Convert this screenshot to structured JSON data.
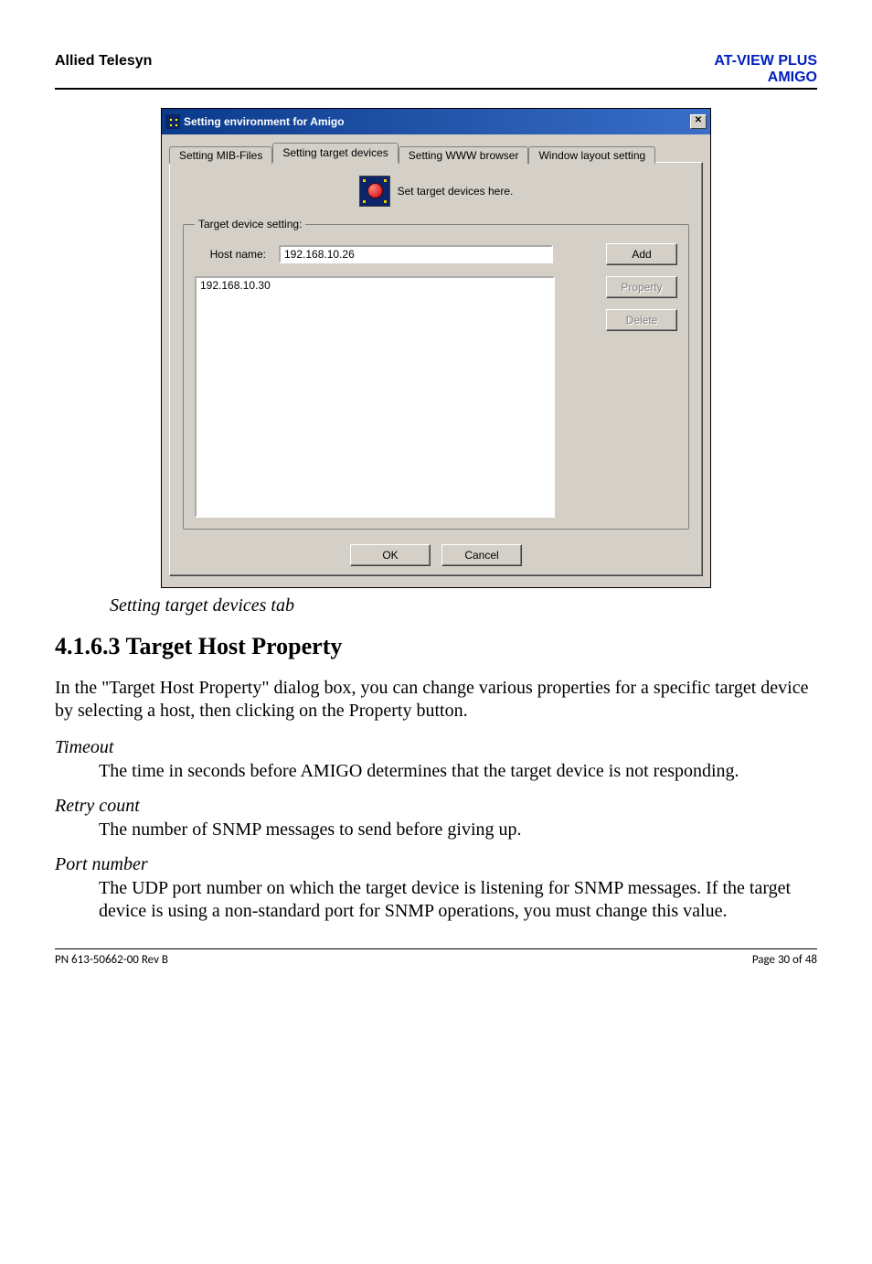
{
  "header": {
    "left": "Allied Telesyn",
    "right_line1": "AT-VIEW PLUS",
    "right_line2": "AMIGO"
  },
  "dialog": {
    "title": "Setting environment for Amigo",
    "close_symbol": "✕",
    "tabs": [
      {
        "label": "Setting MIB-Files",
        "active": false
      },
      {
        "label": "Setting target devices",
        "active": true
      },
      {
        "label": "Setting WWW browser",
        "active": false
      },
      {
        "label": "Window layout setting",
        "active": false
      }
    ],
    "hint": "Set target devices here.",
    "group_label": "Target device setting:",
    "host_label": "Host name:",
    "host_value": "192.168.10.26",
    "add_label": "Add",
    "property_label": "Property",
    "delete_label": "Delete",
    "list_items": [
      "192.168.10.30"
    ],
    "ok_label": "OK",
    "cancel_label": "Cancel"
  },
  "caption": "Setting target devices tab",
  "section_heading": "4.1.6.3 Target Host Property",
  "para1": "In the \"Target Host Property\" dialog box, you can change various properties for a specific target device by selecting a host, then clicking on the Property button.",
  "terms": {
    "timeout_label": "Timeout",
    "timeout_def": "The time in seconds before AMIGO determines that the target device is not responding.",
    "retry_label": "Retry count",
    "retry_def": "The number of SNMP messages to send before giving up.",
    "port_label": "Port number",
    "port_def": "The UDP port number on which the target device is listening for SNMP messages. If the target device is using a non-standard port for SNMP operations, you must change this value."
  },
  "footer": {
    "left": "PN 613-50662-00 Rev B",
    "right": "Page 30 of 48"
  }
}
